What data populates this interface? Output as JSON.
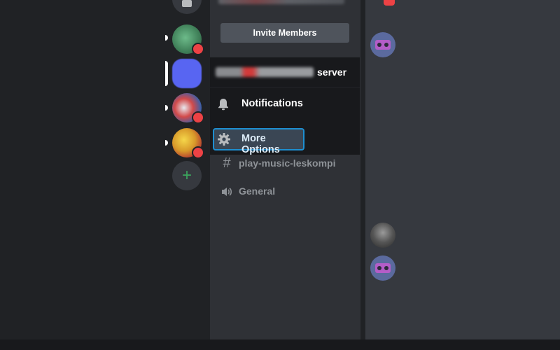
{
  "channel_panel": {
    "invite_button": "Invite Members",
    "channels": [
      {
        "icon": "hashtag-icon",
        "label": "play-music-leskompi"
      },
      {
        "icon": "speaker-icon",
        "label": "General"
      }
    ]
  },
  "context_menu": {
    "server_name_suffix": "server",
    "items": [
      {
        "icon": "bell-icon",
        "label": "Notifications"
      },
      {
        "icon": "gear-icon",
        "label": "More Options",
        "highlighted": true
      }
    ]
  },
  "server_rail": {
    "servers": [
      {
        "name": "server-1",
        "badge": ""
      },
      {
        "name": "server-2",
        "selected": true
      },
      {
        "name": "server-3",
        "badge": ""
      },
      {
        "name": "server-4",
        "badge": ""
      }
    ],
    "add_server_symbol": "+"
  },
  "colors": {
    "accent_highlight": "#1e8fd1",
    "add_green": "#3ba55d",
    "blurple": "#5865f2",
    "badge_red": "#ed4245"
  }
}
